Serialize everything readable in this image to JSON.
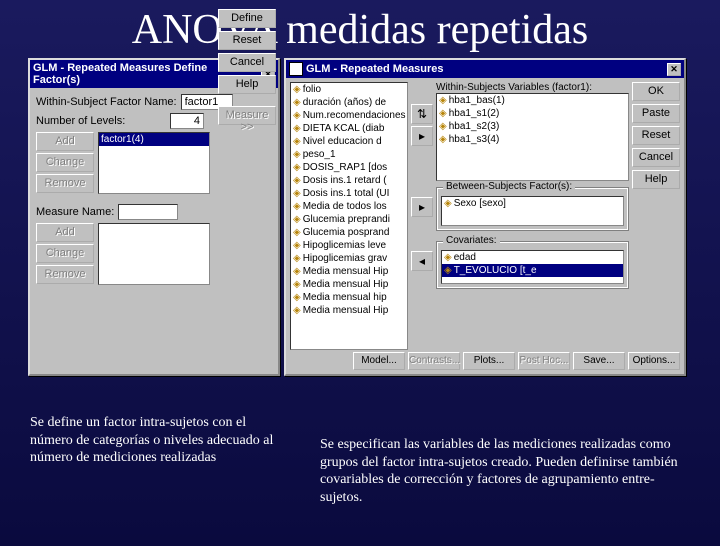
{
  "slide_title": "ANOVA medidas repetidas",
  "dialog1": {
    "title": "GLM - Repeated Measures Define Factor(s)",
    "factor_name_label": "Within-Subject Factor Name:",
    "factor_name_value": "factor1",
    "levels_label": "Number of Levels:",
    "levels_value": "4",
    "list_item": "factor1(4)",
    "measure_label": "Measure Name:",
    "buttons": {
      "add": "Add",
      "change": "Change",
      "remove": "Remove",
      "define": "Define",
      "reset": "Reset",
      "cancel": "Cancel",
      "help": "Help",
      "measure": "Measure >>"
    }
  },
  "dialog2": {
    "title": "GLM - Repeated Measures",
    "within_label": "Within-Subjects Variables (factor1):",
    "between_label": "Between-Subjects Factor(s):",
    "cov_label": "Covariates:",
    "source_vars": [
      "folio",
      "duración (años) de",
      "Num.recomendaciones",
      "DIETA KCAL (diab",
      "Nivel educacion d",
      "peso_1",
      "DOSIS_RAP1 [dos",
      "Dosis ins.1 retard (",
      "Dosis ins.1 total (UI",
      "Media de todos los",
      "Glucemia preprandi",
      "Glucemia posprand",
      "Hipoglicemias leve",
      "Hipoglicemias grav",
      "Media mensual Hip",
      "Media mensual Hip",
      "Media mensual hip",
      "Media mensual Hip"
    ],
    "within_vars": [
      "hba1_bas(1)",
      "hba1_s1(2)",
      "hba1_s2(3)",
      "hba1_s3(4)"
    ],
    "between_vars": [
      "Sexo [sexo]"
    ],
    "cov_vars": [
      "edad",
      "T_EVOLUCIO [t_e"
    ],
    "buttons": {
      "ok": "OK",
      "paste": "Paste",
      "reset": "Reset",
      "cancel": "Cancel",
      "help": "Help",
      "model": "Model...",
      "contrasts": "Contrasts...",
      "plots": "Plots...",
      "posthoc": "Post Hoc...",
      "save": "Save...",
      "options": "Options..."
    }
  },
  "caption_left": "Se define un factor intra-sujetos con el número de categorías o niveles adecuado al número de mediciones realizadas",
  "caption_right": "Se especifican las variables de las mediciones realizadas como grupos del factor intra-sujetos creado. Pueden definirse también covariables de corrección y factores de agrupamiento entre-sujetos."
}
